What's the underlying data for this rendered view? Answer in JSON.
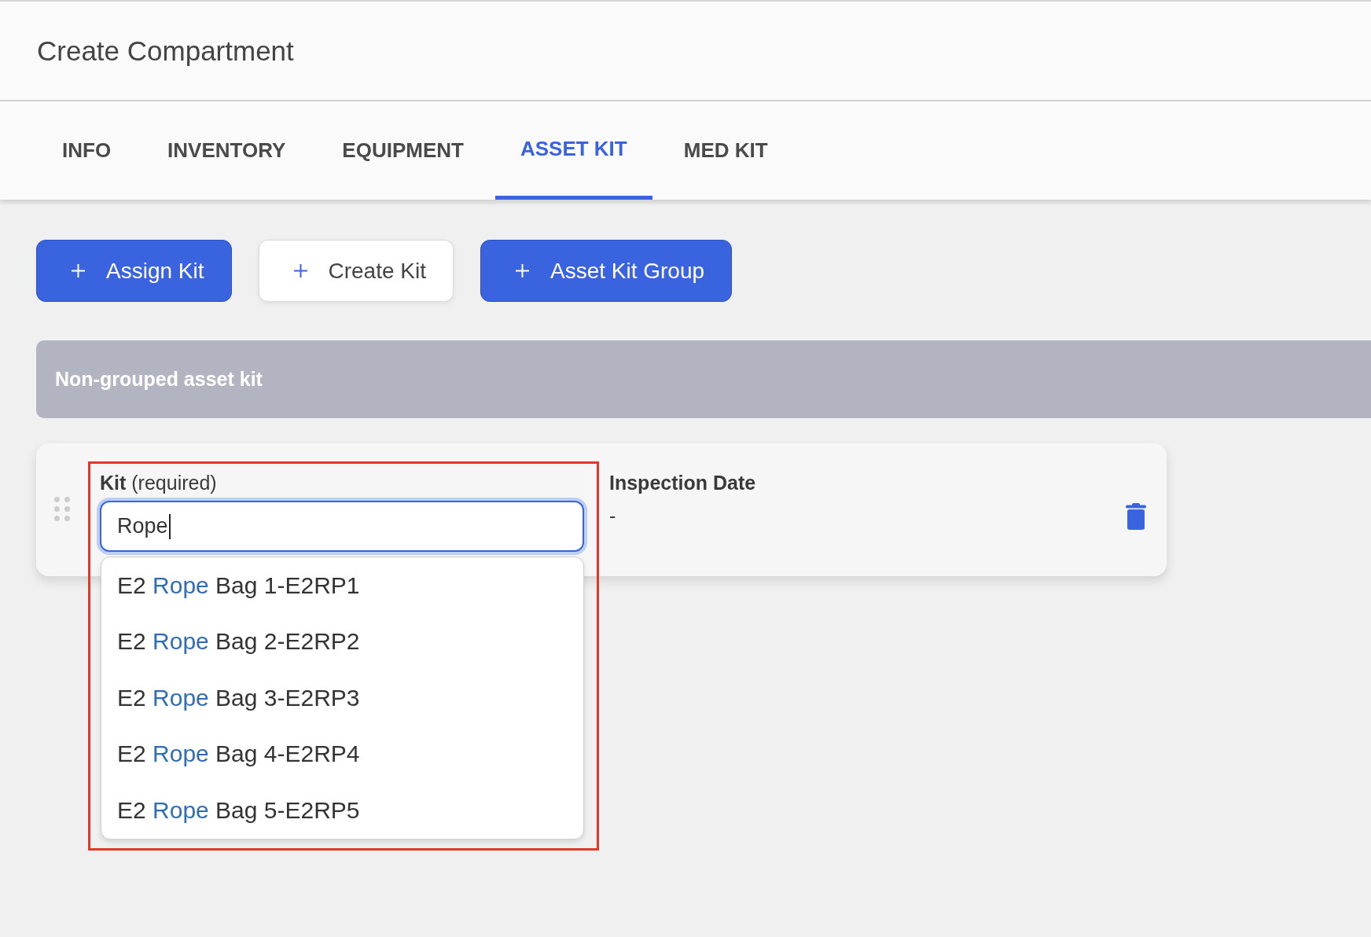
{
  "header": {
    "title": "Create Compartment"
  },
  "tabs": [
    {
      "label": "INFO",
      "selected": false
    },
    {
      "label": "INVENTORY",
      "selected": false
    },
    {
      "label": "EQUIPMENT",
      "selected": false
    },
    {
      "label": "ASSET KIT",
      "selected": true
    },
    {
      "label": "MED KIT",
      "selected": false
    }
  ],
  "actions": [
    {
      "label": "Assign Kit",
      "kind": "primary"
    },
    {
      "label": "Create Kit",
      "kind": "secondary"
    },
    {
      "label": "Asset Kit Group",
      "kind": "primary"
    }
  ],
  "section": {
    "title": "Non-grouped asset kit"
  },
  "kit_row": {
    "kit_field": {
      "label": "**Kit** (required)",
      "value": "Rope",
      "focused": true,
      "highlighted": true,
      "suggestions": [
        {
          "prefix": "E2",
          "match": "Rope",
          "suffix": "Bag 1-E2RP1"
        },
        {
          "prefix": "E2",
          "match": "Rope",
          "suffix": "Bag 2-E2RP2"
        },
        {
          "prefix": "E2",
          "match": "Rope",
          "suffix": "Bag 3-E2RP3"
        },
        {
          "prefix": "E2",
          "match": "Rope",
          "suffix": "Bag 4-E2RP4"
        },
        {
          "prefix": "E2",
          "match": "Rope",
          "suffix": "Bag 5-E2RP5"
        }
      ]
    },
    "inspection_date": {
      "label": "Inspection Date",
      "value": "-"
    }
  }
}
